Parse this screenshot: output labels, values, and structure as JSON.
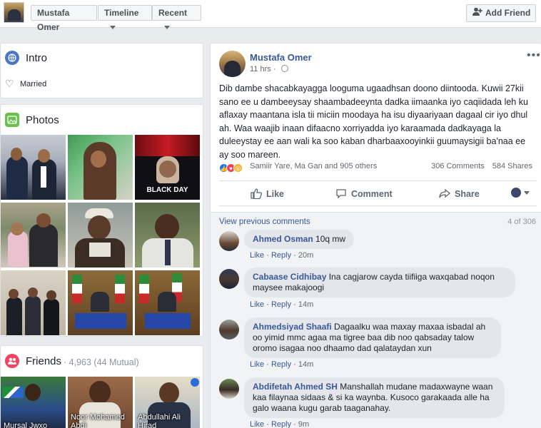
{
  "topbar": {
    "profile_name": "Mustafa Omer",
    "timeline_label": "Timeline",
    "recent_label": "Recent",
    "add_friend_label": "Add Friend"
  },
  "intro": {
    "title": "Intro",
    "relationship": "Married"
  },
  "photos": {
    "title": "Photos",
    "black_day_text": "BLACK DAY"
  },
  "friends": {
    "title": "Friends",
    "count": "4,963 (44 Mutual)",
    "separator": "·",
    "items": [
      {
        "name": "Mursal Jwxo"
      },
      {
        "name": "Noor Mohamed Abdi"
      },
      {
        "name": "Abdullahi Ali Hirad"
      }
    ]
  },
  "post": {
    "author": "Mustafa Omer",
    "time": "11 hrs",
    "body": "Dib dambe shacabkayagga looguma ugaadhsan doono diintooda. Kuwii 27kii sano ee u dambeeysay shaambadeeynta dadka iimaanka iyo caqiidada leh ku aflaxay maantana isla tii miciin moodaya ha isu diyaariyaan dagaal cir iyo dhul ah. Waa waajib inaan difaacno xorriyadda iyo karaamada dadkayaga la duleeystay ee aan wali ka soo kaban dharbaaxooyinkii guumaysigii ba'naa ee ay soo mareen.",
    "reaction_names": "Samiir Yare, Ma Gan and 905 others",
    "comments_count": "306 Comments",
    "shares_count": "584 Shares",
    "actions": {
      "like": "Like",
      "comment": "Comment",
      "share": "Share"
    },
    "view_previous": "View previous comments",
    "page_count": "4 of 306"
  },
  "comments": [
    {
      "name": "Ahmed Osman",
      "text": "10q mw",
      "like": "Like",
      "reply": "Reply",
      "time": "20m"
    },
    {
      "name": "Cabaase Cidhibay",
      "text": "Ina cagjarow cayda tiifiiga waxqabad noqon maysee makajoogi",
      "like": "Like",
      "reply": "Reply",
      "time": "14m"
    },
    {
      "name": "Ahmedsiyad Shaafi",
      "text": "Dagaalku waa maxay maxaa isbadal ah oo yimid mmc agaa ma tigree baa dib noo qabsaday talow oromo isagaa noo dhaamo dad qalataydan xun",
      "like": "Like",
      "reply": "Reply",
      "time": "14m"
    },
    {
      "name": "Abdifetah Ahmed SH",
      "text": "Manshallah mudane madaxwayne waan kaa filaynaa sidaas & si ka waynba. Kusoco garakaada alle ha galo waana kugu garab taaganahay.",
      "like": "Like",
      "reply": "Reply",
      "time": "9m"
    }
  ],
  "colors": {
    "link_blue": "#365899",
    "background": "#e9ebee",
    "like_blue": "#1877f2",
    "love_red": "#f33e58",
    "wow_yellow": "#f7b125"
  }
}
